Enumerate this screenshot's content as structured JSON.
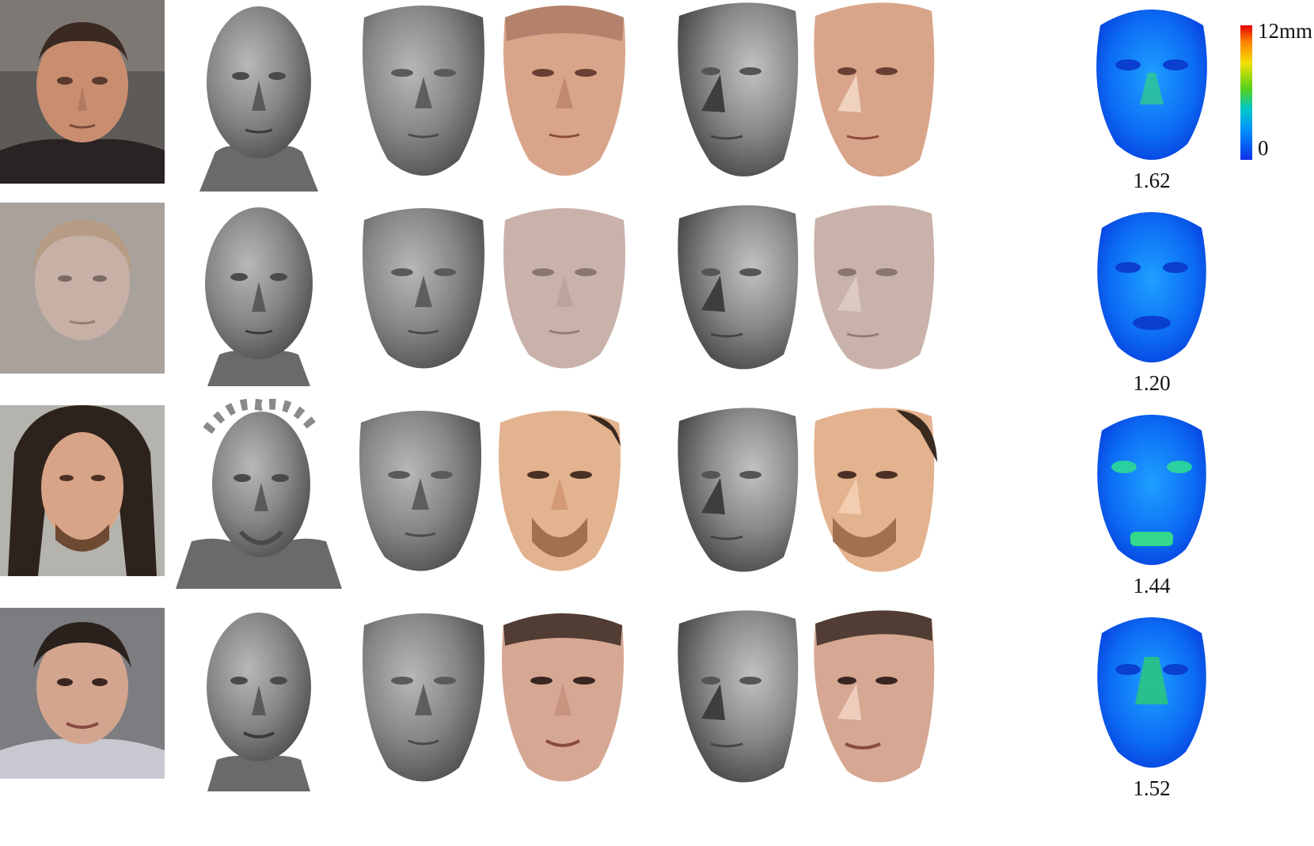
{
  "figure": {
    "rows": [
      {
        "score": "1.62"
      },
      {
        "score": "1.20"
      },
      {
        "score": "1.44"
      },
      {
        "score": "1.52"
      }
    ],
    "colorbar": {
      "max_label": "12mm",
      "min_label": "0"
    },
    "colors": {
      "mesh_gray": "#7a7a7a",
      "skin_row1": "#d9a58a",
      "skin_row2": "#c9b2aa",
      "skin_row3": "#e3b28e",
      "skin_row4": "#d6a792",
      "heat_blue": "#0a56f0"
    }
  }
}
